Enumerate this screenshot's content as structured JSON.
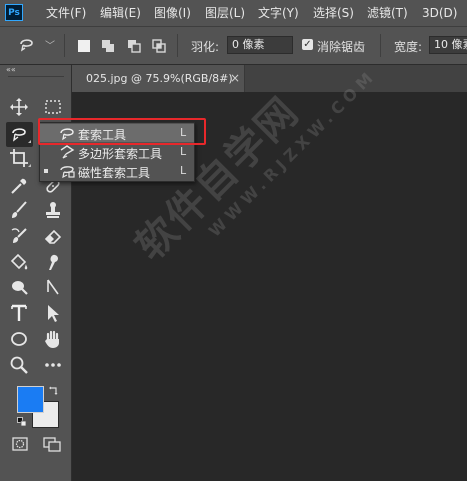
{
  "app": {
    "logo": "Ps"
  },
  "menubar": {
    "items": [
      "文件(F)",
      "编辑(E)",
      "图像(I)",
      "图层(L)",
      "文字(Y)",
      "选择(S)",
      "滤镜(T)",
      "3D(D)"
    ]
  },
  "options": {
    "feather_label": "羽化:",
    "feather_value": "0 像素",
    "antialias_label": "消除锯齿",
    "antialias_checked": true,
    "width_label": "宽度:",
    "width_value": "10 像素"
  },
  "document": {
    "tab_title": "025.jpg @ 75.9%(RGB/8#)",
    "close": "×"
  },
  "flyout": {
    "items": [
      {
        "label": "套索工具",
        "shortcut": "L",
        "icon": "lasso-icon"
      },
      {
        "label": "多边形套索工具",
        "shortcut": "L",
        "icon": "polygonal-lasso-icon"
      },
      {
        "label": "磁性套索工具",
        "shortcut": "L",
        "icon": "magnetic-lasso-icon"
      }
    ]
  },
  "toolbar": {
    "collapse": "««",
    "tools": [
      "move-icon",
      "marquee-icon",
      "lasso-icon",
      "quick-select-icon",
      "crop-icon",
      "frame-icon",
      "eyedropper-icon",
      "healing-icon",
      "brush-icon",
      "stamp-icon",
      "history-brush-icon",
      "eraser-icon",
      "bucket-icon",
      "smudge-icon",
      "dodge-icon",
      "pen-icon",
      "type-icon",
      "path-select-icon",
      "ellipse-icon",
      "hand-icon",
      "zoom-icon",
      "more-icon"
    ]
  },
  "colors": {
    "foreground": "#1a7cf3",
    "background": "#ececec",
    "highlight": "#e8282b"
  },
  "watermark": {
    "main": "软件自学网",
    "sub": "WWW.RJZXW.COM"
  }
}
